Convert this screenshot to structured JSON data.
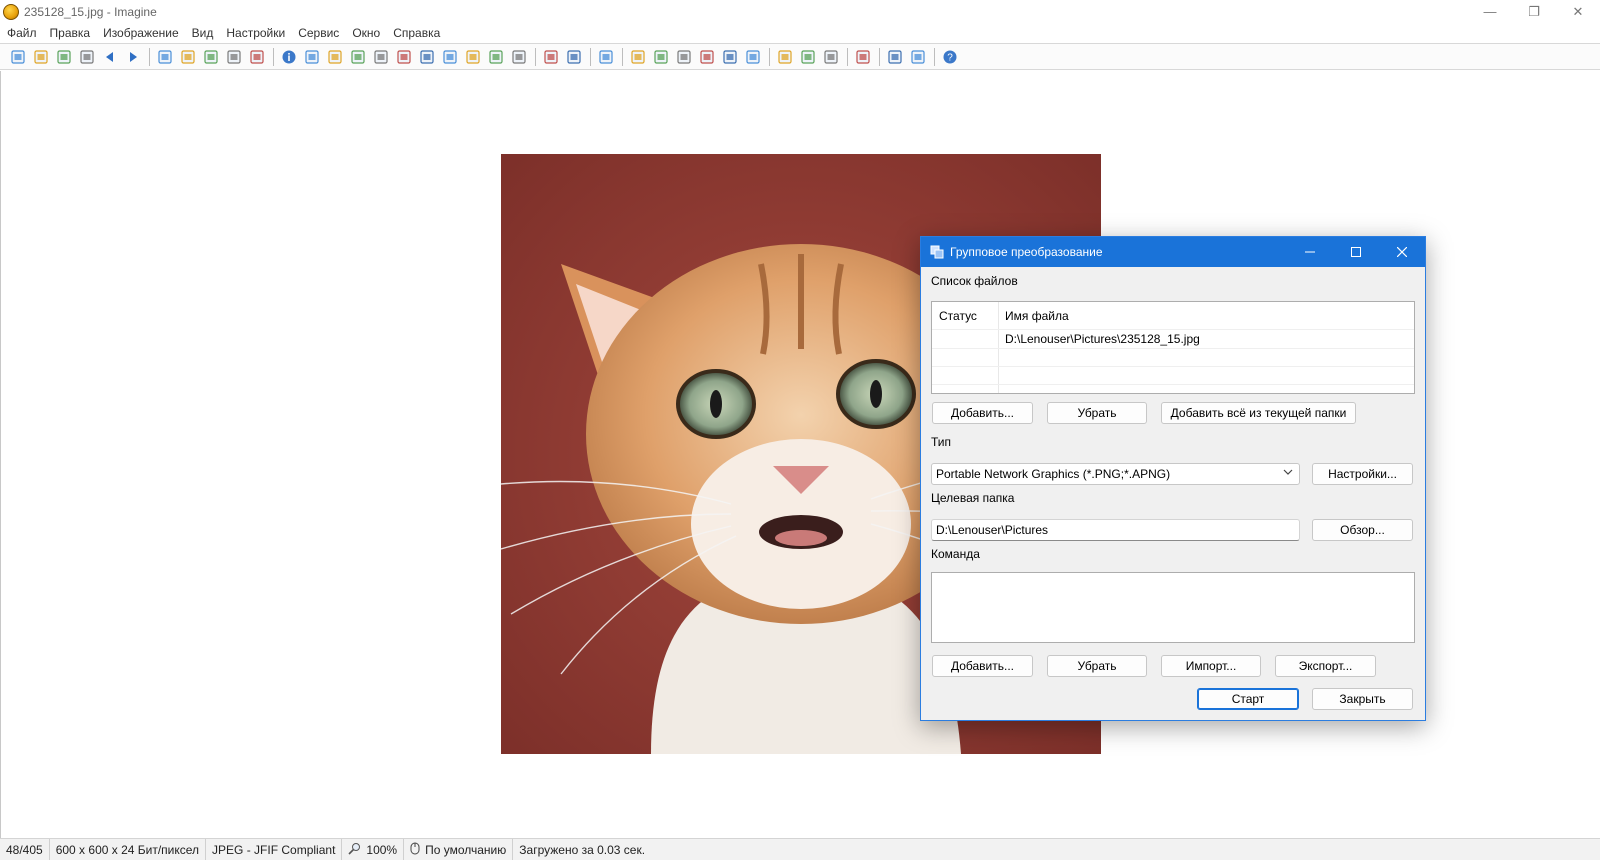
{
  "window": {
    "title": "235128_15.jpg - Imagine",
    "minimize_glyph": "—",
    "restore_glyph": "❐",
    "close_glyph": "✕"
  },
  "menu": [
    "Файл",
    "Правка",
    "Изображение",
    "Вид",
    "Настройки",
    "Сервис",
    "Окно",
    "Справка"
  ],
  "toolbar": {
    "icons": [
      "new-icon",
      "open-icon",
      "save-all-icon",
      "print-icon",
      "prev-icon",
      "next-icon",
      "sep",
      "cut-icon",
      "copy-icon",
      "paste-icon",
      "undo-icon",
      "redo-icon",
      "sep",
      "info-icon",
      "camera-icon",
      "crop-icon",
      "resize-icon",
      "grayscale-icon",
      "image-adjust-icon",
      "effects-icon",
      "rotate-icon",
      "frame-icon",
      "flip-icon",
      "transform-icon",
      "sep",
      "zoom-in-icon",
      "zoom-out-icon",
      "sep",
      "refresh-icon",
      "sep",
      "tool-1-icon",
      "tool-2-icon",
      "tool-3-icon",
      "view-1-icon",
      "view-2-icon",
      "view-3-icon",
      "sep",
      "monitor-icon",
      "thumbnails-icon",
      "paint-icon",
      "sep",
      "settings-wrench-icon",
      "sep",
      "batch-icon",
      "batch-convert-icon",
      "sep",
      "help-icon"
    ]
  },
  "statusbar": {
    "index": "48/405",
    "dimensions": "600 x 600 x 24 Бит/пиксел",
    "format": "JPEG - JFIF Compliant",
    "zoom": "100%",
    "mode": "По умолчанию",
    "loaded": "Загружено за 0.03 сек."
  },
  "dialog": {
    "title": "Групповое преобразование",
    "file_list_label": "Список файлов",
    "col_status": "Статус",
    "col_filename": "Имя файла",
    "files": [
      {
        "status": "",
        "path": "D:\\Lenouser\\Pictures\\235128_15.jpg"
      }
    ],
    "add_button": "Добавить...",
    "remove_button": "Убрать",
    "add_all_button": "Добавить всё из текущей папки",
    "type_label": "Тип",
    "type_value": "Portable Network Graphics (*.PNG;*.APNG)",
    "type_settings_button": "Настройки...",
    "target_folder_label": "Целевая папка",
    "target_folder_value": "D:\\Lenouser\\Pictures",
    "browse_button": "Обзор...",
    "command_label": "Команда",
    "cmd_add_button": "Добавить...",
    "cmd_remove_button": "Убрать",
    "import_button": "Импорт...",
    "export_button": "Экспорт...",
    "start_button": "Старт",
    "close_button": "Закрыть"
  },
  "colors": {
    "dialog_titlebar": "#1a73d9",
    "background_red": "#8e3a33"
  }
}
